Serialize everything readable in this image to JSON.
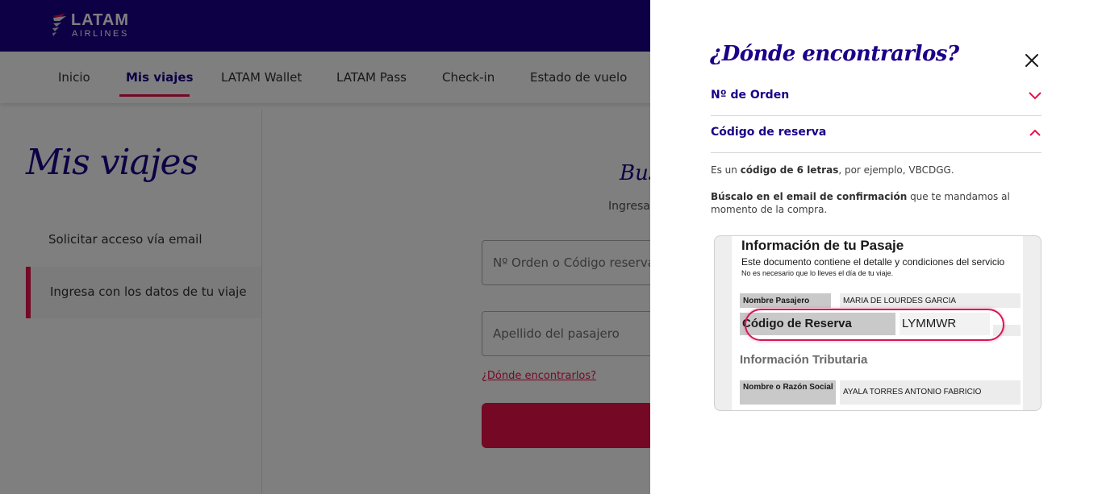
{
  "brand": {
    "name": "LATAM",
    "subname": "AIRLINES"
  },
  "colors": {
    "header": "#1b0088",
    "accent": "#e8114b",
    "overlay": "rgba(0,0,0,0.5)"
  },
  "nav": {
    "items": [
      {
        "label": "Inicio"
      },
      {
        "label": "Mis viajes",
        "active": true
      },
      {
        "label": "LATAM Wallet"
      },
      {
        "label": "LATAM Pass"
      },
      {
        "label": "Check-in"
      },
      {
        "label": "Estado de vuelo"
      }
    ]
  },
  "page": {
    "title": "Mis viajes",
    "side_links": [
      "Solicitar acceso vía email",
      "Ingresa con los datos de tu viaje"
    ],
    "search_title": "Bus",
    "search_subtitle": "Ingresa",
    "order_placeholder": "Nº Orden o Código reserva",
    "lastname_placeholder": "Apellido del pasajero",
    "where_link": "¿Dónde encontrarlos?"
  },
  "drawer": {
    "title": "¿Dónde encontrarlos?",
    "close_icon": "close-icon",
    "accordion": [
      {
        "label": "Nº de Orden",
        "expanded": false,
        "icon": "chevron-down-icon"
      },
      {
        "label": "Código de reserva",
        "expanded": true,
        "icon": "chevron-up-icon"
      }
    ],
    "desc1": {
      "pre": "Es un ",
      "bold": "código de 6 letras",
      "post": ", por ejemplo, VBCDGG."
    },
    "desc2": {
      "bold": "Búscalo en el email de confirmación",
      "post": " que te mandamos al momento de la compra."
    }
  },
  "ticket": {
    "heading": "Información de tu Pasaje",
    "line1": "Este documento contiene el detalle y condiciones del servicio",
    "line2": "No es necesario que lo lleves el día de tu viaje.",
    "passenger_label": "Nombre Pasajero",
    "passenger_value": "MARIA DE LOURDES GARCIA",
    "code_label": "Código de Reserva",
    "code_value": "LYMMWR",
    "tax_section": "Información Tributaria",
    "company_label": "Nombre o Razón Social",
    "company_value": "AYALA TORRES ANTONIO FABRICIO"
  }
}
